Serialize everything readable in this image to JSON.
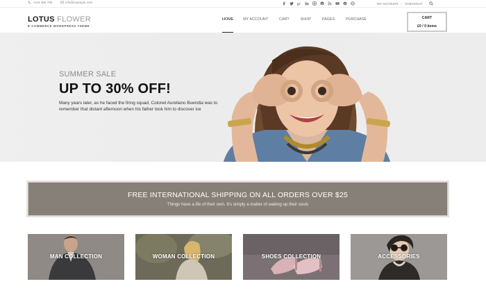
{
  "topbar": {
    "phone": "+123 456 789",
    "email": "info@example.com",
    "social_icons": [
      "facebook-icon",
      "twitter-icon",
      "google-plus-icon",
      "linkedin-icon",
      "instagram-icon",
      "pinterest-icon",
      "rss-icon",
      "youtube-icon",
      "skype-icon",
      "dribbble-icon"
    ],
    "account_link": "MY ACCOUNT",
    "checkout_link": "CHECKOUT",
    "separator": "/"
  },
  "header": {
    "logo_bold": "LOTUS",
    "logo_light": "FLOWER",
    "tagline": "E-COMMERCE WORDPRESS THEME",
    "nav": [
      {
        "label": "HOME",
        "active": true
      },
      {
        "label": "MY ACCOUNT",
        "active": false
      },
      {
        "label": "CART",
        "active": false
      },
      {
        "label": "SHOP",
        "active": false
      },
      {
        "label": "PAGES",
        "active": false
      },
      {
        "label": "PURCHASE",
        "active": false
      }
    ],
    "cart_title": "CART",
    "cart_summary": "£0 / 0 items"
  },
  "hero": {
    "pretitle": "SUMMER SALE",
    "title": "UP TO 30% OFF!",
    "description": "Many years later, as he faced the firing squad, Colonel Aureliano Buendia was to remember that distant afternoon when his father took him to discover ice"
  },
  "banner": {
    "heading": "FREE INTERNATIONAL SHIPPING ON ALL ORDERS OVER $25",
    "subheading": "Things have a life of their own. It's simply a matter of waking up their souls"
  },
  "collections": [
    {
      "label": "MAN COLLECTION"
    },
    {
      "label": "WOMAN COLLECTION"
    },
    {
      "label": "SHOES COLLECTION"
    },
    {
      "label": "ACCESSORIES"
    }
  ],
  "colors": {
    "banner_bg": "#878078",
    "hero_bg": "#ededed",
    "accent": "#111111"
  }
}
